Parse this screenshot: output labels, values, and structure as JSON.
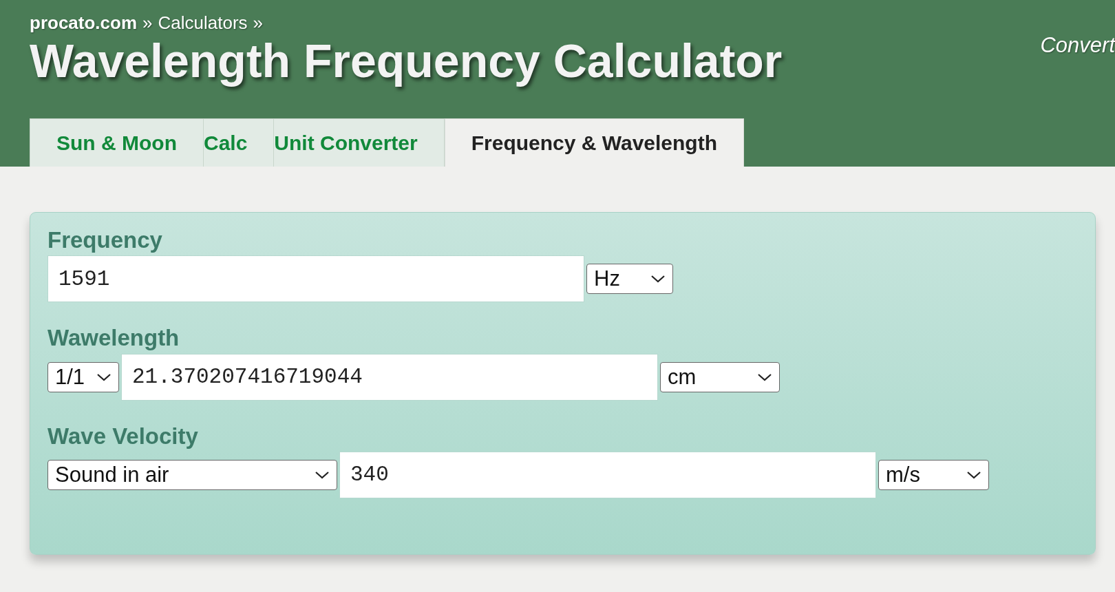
{
  "breadcrumb": {
    "links": [
      "procato.com",
      "Calculators"
    ],
    "separator": "»"
  },
  "title": "Wavelength Frequency Calculator",
  "header_side_text": "Convert",
  "tabs": [
    {
      "label": "Sun & Moon",
      "selected": false
    },
    {
      "label": "Calc",
      "selected": false
    },
    {
      "label": "Unit Converter",
      "selected": false
    },
    {
      "label": "Frequency & Wavelength",
      "selected": true
    }
  ],
  "fields": [
    {
      "label": "Frequency",
      "controls": [
        {
          "kind": "input",
          "value": "1591"
        },
        {
          "kind": "select",
          "value": "Hz"
        }
      ]
    },
    {
      "label": "Wawelength",
      "controls": [
        {
          "kind": "select",
          "value": "1/1"
        },
        {
          "kind": "input",
          "value": "21.370207416719044"
        },
        {
          "kind": "select",
          "value": "cm"
        }
      ]
    },
    {
      "label": "Wave Velocity",
      "controls": [
        {
          "kind": "select",
          "value": "Sound in air"
        },
        {
          "kind": "input",
          "value": "340"
        },
        {
          "kind": "select",
          "value": "m/s"
        }
      ]
    }
  ]
}
